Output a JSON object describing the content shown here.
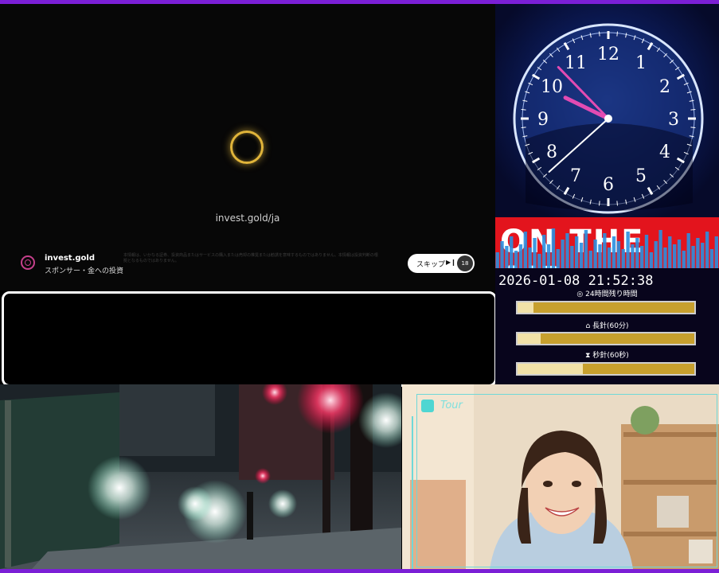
{
  "ad": {
    "url": "invest.gold/ja",
    "sponsor_name": "invest.gold",
    "sponsor_sub": "スポンサー・金への投資",
    "disclaimer": "本情報は、いかなる証券、投資商品またはサービスの購入または売却の推奨または勧誘を意味するものではありません。本情報は投資判断の根拠となるものではありません。",
    "skip_label": "スキップ",
    "skip_icon": "▶❙",
    "skip_countdown": "18"
  },
  "clock": {
    "numbers": [
      "12",
      "1",
      "2",
      "3",
      "4",
      "5",
      "6",
      "7",
      "8",
      "9",
      "10",
      "11"
    ],
    "time_shown": "21:52:38",
    "onair": "ON THE AIR",
    "datetime": "2026-01-08 21:52:38",
    "label_day": "24時間残り時間",
    "label_hour": "長針(60分)",
    "label_minute": "秒針(60秒)",
    "progress_day": 0.09,
    "progress_hour": 0.13,
    "progress_minute": 0.37
  },
  "webcam": {
    "title": "Tour"
  },
  "colors": {
    "accent_purple": "#7b1fd6",
    "onair_red": "#e3141d",
    "bar_gold": "#c7a02e",
    "eq_blue": "#2a8fe0"
  }
}
